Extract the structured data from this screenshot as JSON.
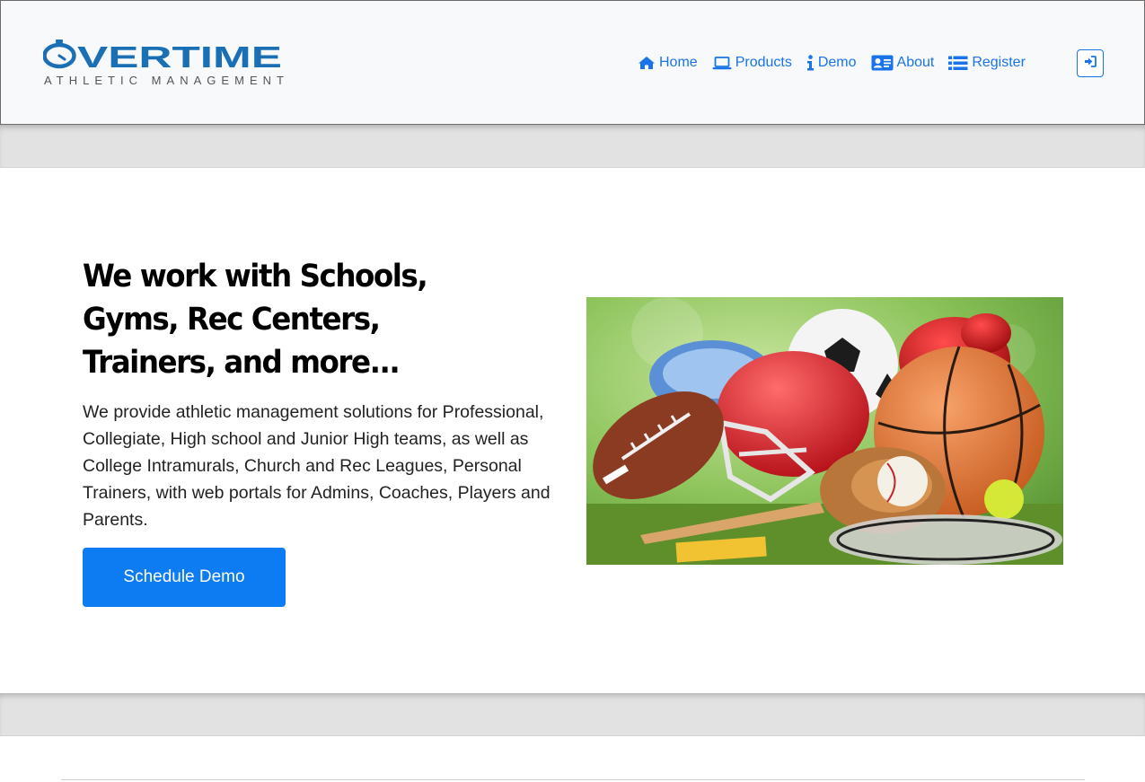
{
  "brand": {
    "name": "OVERTIME",
    "tagline": "ATHLETIC MANAGEMENT",
    "color": "#1a6fb5"
  },
  "nav": {
    "items": [
      {
        "label": "Home",
        "icon": "home-icon"
      },
      {
        "label": "Products",
        "icon": "laptop-icon"
      },
      {
        "label": "Demo",
        "icon": "info-icon"
      },
      {
        "label": "About",
        "icon": "id-card-icon"
      },
      {
        "label": "Register",
        "icon": "list-icon"
      }
    ],
    "login_icon": "sign-in-icon",
    "accent": "#1a73e8"
  },
  "hero": {
    "title": "We work with Schools, Gyms, Rec Centers, Trainers, and more...",
    "description": "We provide athletic management solutions for Professional, Collegiate, High school and Junior High teams, as well as College Intramurals, Church and Rec Leagues, Personal Trainers, with web portals for Admins, Coaches, Players and Parents.",
    "cta_label": "Schedule Demo",
    "cta_color": "#0d7cf2"
  }
}
